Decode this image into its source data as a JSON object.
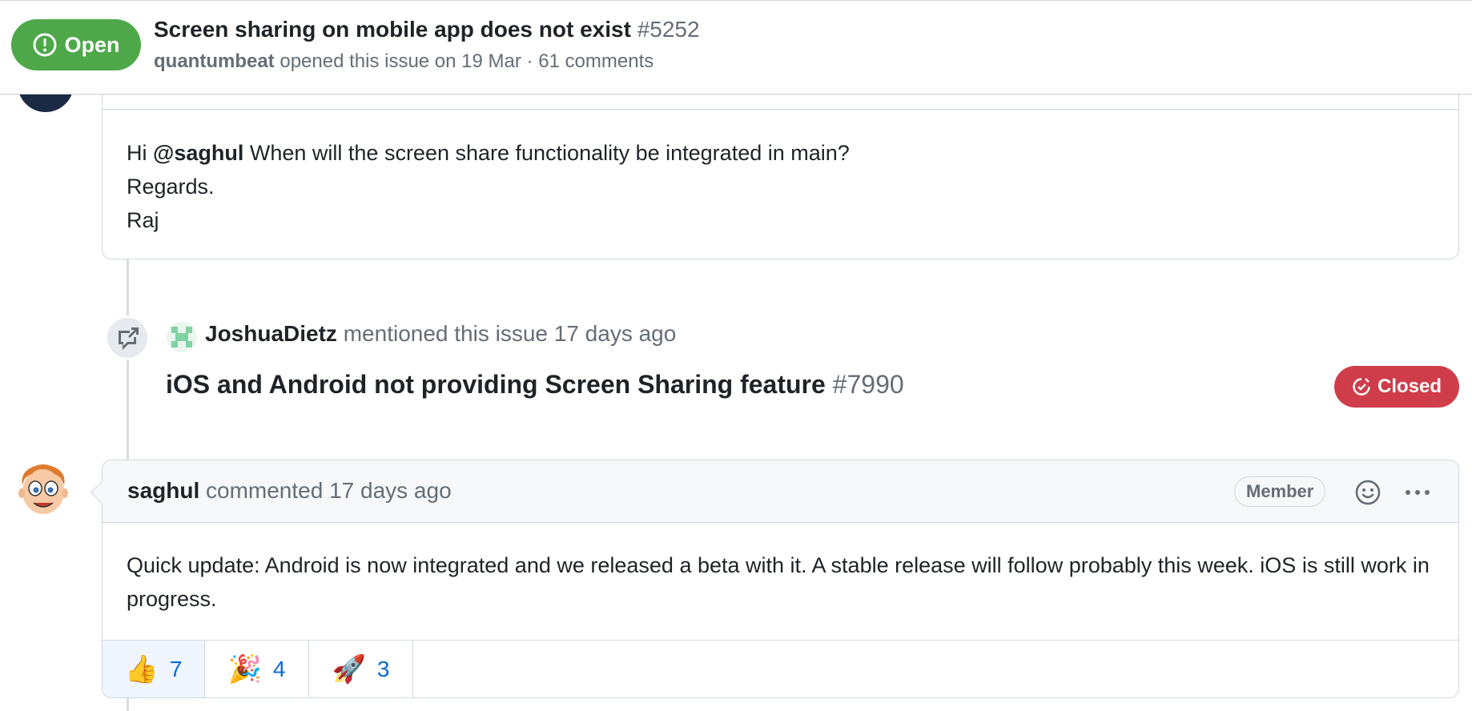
{
  "header": {
    "state_label": "Open",
    "title": "Screen sharing on mobile app does not exist",
    "number": "#5252",
    "author": "quantumbeat",
    "meta": "opened this issue on 19 Mar · 61 comments",
    "state_color": "#4ea84a"
  },
  "comment1": {
    "greeting": "Hi",
    "mention": "@saghul",
    "line1_rest": "When will the screen share functionality be integrated in main?",
    "line2": "Regards.",
    "line3": "Raj"
  },
  "event": {
    "icon": "cross-reference-icon",
    "actor": "JoshuaDietz",
    "action": "mentioned this issue 17 days ago",
    "ref_title": "iOS and Android not providing Screen Sharing feature",
    "ref_number": "#7990",
    "ref_state": "Closed",
    "ref_state_color": "#cf3d4a"
  },
  "comment2": {
    "author": "saghul",
    "action": "commented 17 days ago",
    "role_badge": "Member",
    "body": "Quick update: Android is now integrated and we released a beta with it. A stable release will follow probably this week. iOS is still work in progress.",
    "reactions": [
      {
        "emoji": "👍",
        "name": "thumbs-up",
        "count": "7"
      },
      {
        "emoji": "🎉",
        "name": "tada",
        "count": "4"
      },
      {
        "emoji": "🚀",
        "name": "rocket",
        "count": "3"
      }
    ]
  }
}
